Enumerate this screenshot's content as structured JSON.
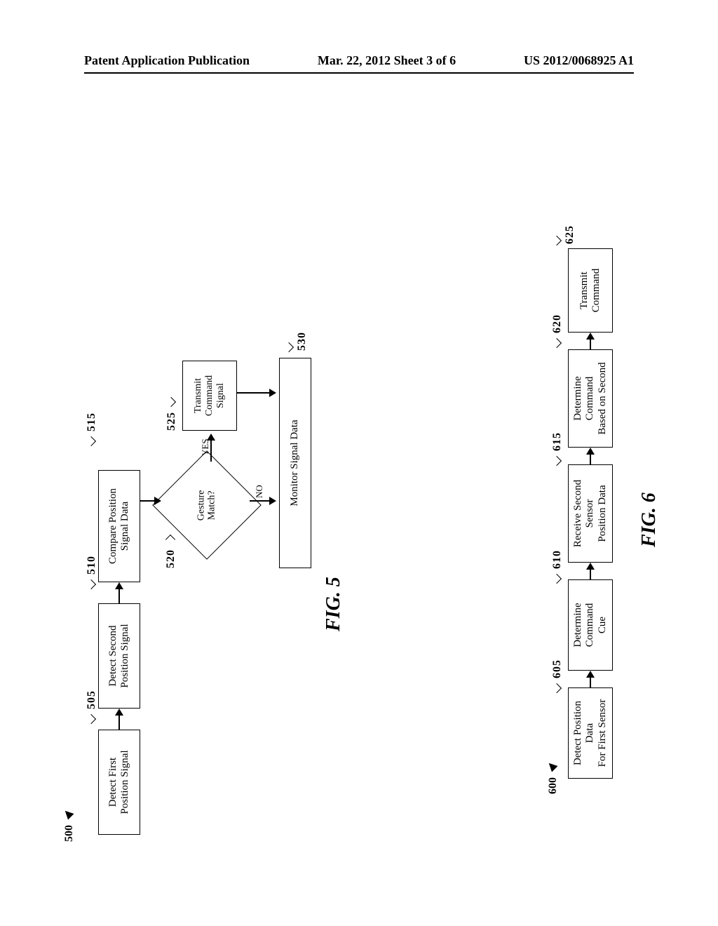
{
  "header": {
    "left": "Patent Application Publication",
    "center": "Mar. 22, 2012  Sheet 3 of 6",
    "right": "US 2012/0068925 A1"
  },
  "fig5": {
    "id": "500",
    "label": "FIG. 5",
    "steps": {
      "s505": {
        "ref": "505",
        "text": "Detect First\nPosition Signal"
      },
      "s510": {
        "ref": "510",
        "text": "Detect Second\nPosition Signal"
      },
      "s515": {
        "ref": "515",
        "text": "Compare Position\nSignal Data"
      },
      "s520": {
        "ref": "520",
        "text": "Gesture\nMatch?"
      },
      "s525": {
        "ref": "525",
        "text": "Transmit\nCommand\nSignal"
      },
      "s530": {
        "ref": "530",
        "text": "Monitor Signal Data"
      }
    },
    "branches": {
      "yes": "YES",
      "no": "NO"
    }
  },
  "fig6": {
    "id": "600",
    "label": "FIG. 6",
    "steps": {
      "s605": {
        "ref": "605",
        "text": "Detect Position Data\nFor First Sensor"
      },
      "s610": {
        "ref": "610",
        "text": "Determine Command\nCue"
      },
      "s615": {
        "ref": "615",
        "text": "Receive Second Sensor\nPosition Data"
      },
      "s620": {
        "ref": "620",
        "text": "Determine Command\nBased on Second"
      },
      "s625": {
        "ref": "625",
        "text": "Transmit Command"
      }
    }
  }
}
